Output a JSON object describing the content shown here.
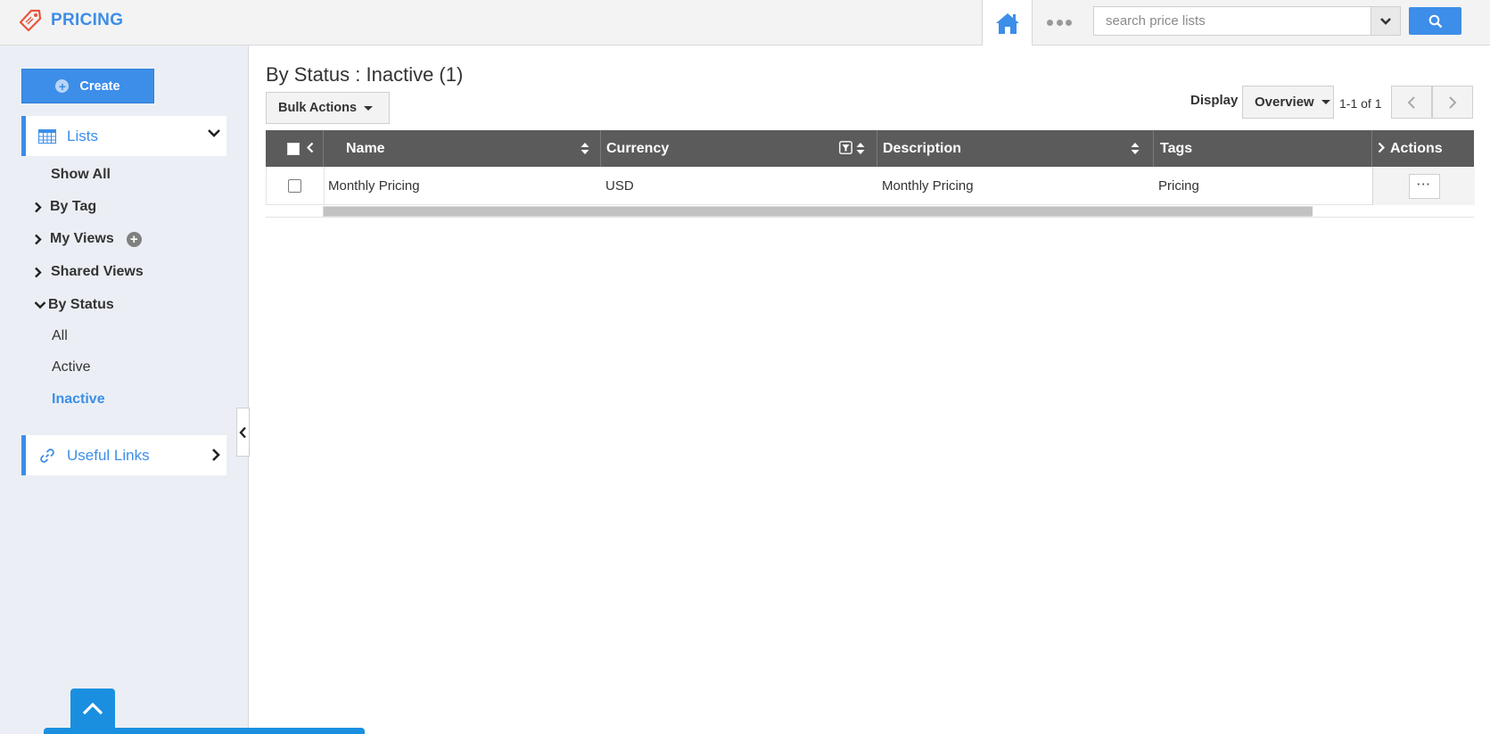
{
  "app": {
    "title": "PRICING",
    "accent": "#3c8ee8"
  },
  "header": {
    "search_placeholder": "search price lists"
  },
  "sidebar": {
    "create_label": "Create",
    "lists_label": "Lists",
    "items": {
      "show_all": "Show All",
      "by_tag": "By Tag",
      "my_views": "My Views",
      "shared_views": "Shared Views",
      "by_status": "By Status",
      "status_all": "All",
      "status_active": "Active",
      "status_inactive": "Inactive"
    },
    "useful_links_label": "Useful Links"
  },
  "main": {
    "title": "By Status : Inactive (1)",
    "bulk_actions_label": "Bulk Actions",
    "display_label": "Display",
    "display_value": "Overview",
    "page_count": "1-1 of 1"
  },
  "grid": {
    "columns": [
      "Name",
      "Currency",
      "Description",
      "Tags",
      "Actions"
    ],
    "rows": [
      {
        "name": "Monthly Pricing",
        "currency": "USD",
        "description": "Monthly Pricing",
        "tags": "Pricing"
      }
    ],
    "actions_button": "···"
  }
}
